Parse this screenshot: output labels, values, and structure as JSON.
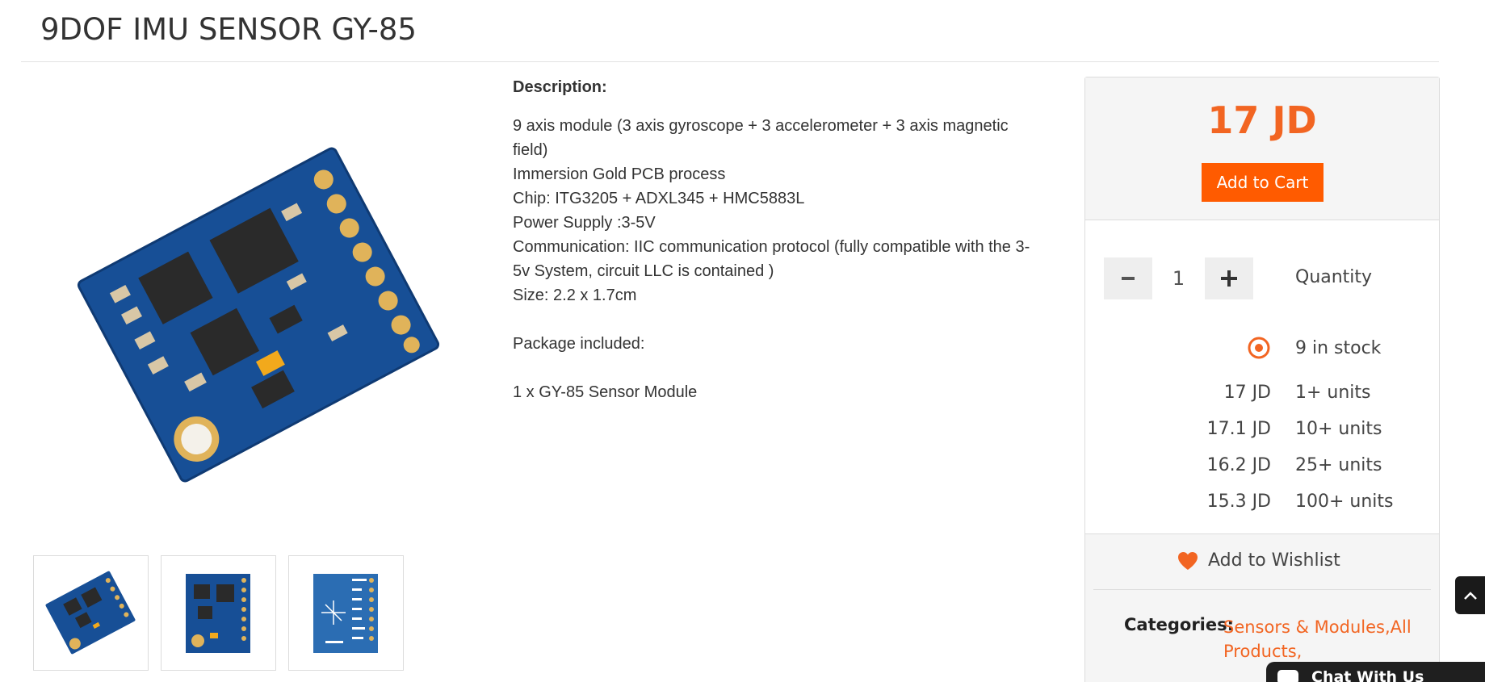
{
  "product": {
    "title": "9DOF IMU SENSOR GY-85",
    "image_alt": "GY-85 9DOF IMU sensor board",
    "thumbnails": [
      {
        "name": "front-angled"
      },
      {
        "name": "front-top"
      },
      {
        "name": "back-pinout"
      }
    ]
  },
  "description": {
    "heading": "Description:",
    "lines": [
      "9 axis module (3 axis gyroscope + 3 accelerometer + 3 axis magnetic",
      "field)",
      "Immersion Gold PCB process",
      "Chip: ITG3205 + ADXL345 + HMC5883L",
      "Power Supply :3-5V",
      "Communication: IIC communication protocol (fully compatible with the 3-",
      "5v System, circuit LLC is contained )",
      "Size: 2.2 x 1.7cm",
      "",
      "Package included:",
      "",
      "1 x GY-85 Sensor Module"
    ]
  },
  "purchase": {
    "price": "17 JD",
    "add_to_cart_label": "Add to Cart",
    "quantity_value": "1",
    "quantity_label": "Quantity",
    "minus_symbol": "−",
    "plus_symbol": "+",
    "stock_text": "9 in stock",
    "tiers": [
      {
        "price": "17 JD",
        "units": "1+ units"
      },
      {
        "price": "17.1 JD",
        "units": "10+ units"
      },
      {
        "price": "16.2 JD",
        "units": "25+ units"
      },
      {
        "price": "15.3 JD",
        "units": "100+ units"
      }
    ],
    "wishlist_label": "Add to Wishlist",
    "categories_label": "Categories:",
    "categories": [
      "Sensors & Modules,",
      "All",
      "Products,"
    ]
  },
  "chat": {
    "label": "Chat With Us"
  },
  "colors": {
    "accent": "#f26522",
    "button": "#ff5b00",
    "panel_bg": "#f5f5f5"
  },
  "icons": {
    "minus": "minus-icon",
    "plus": "plus-icon",
    "stock": "target-circle-icon",
    "wishlist": "heart-icon",
    "scroll_top": "chevron-up-icon",
    "chat": "chat-bubble-icon"
  }
}
